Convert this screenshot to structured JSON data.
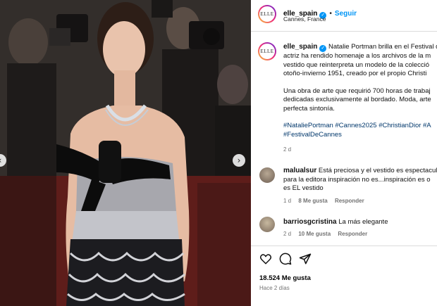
{
  "header": {
    "avatar_text": "ELLE",
    "username": "elle_spain",
    "separator": "•",
    "follow_label": "Seguir",
    "location": "Cannes, France"
  },
  "caption": {
    "username": "elle_spain",
    "lines": [
      "Natalie Portman brilla en el Festival d",
      "actriz ha rendido homenaje a los archivos de la m",
      "vestido que reinterpreta un modelo de la colecció",
      "otoño-invierno 1951, creado por el propio Christi"
    ],
    "lines2": [
      "Una obra de arte que requirió 700 horas de trabaj",
      "dedicadas exclusivamente al bordado. Moda, arte",
      "perfecta sintonía."
    ],
    "hashtags": [
      "#NataliePortman #Cannes2025 #ChristianDior #A",
      "#FestivalDeCannes"
    ],
    "time": "2 d"
  },
  "comments": [
    {
      "username": "malualsur",
      "lines": [
        "Está preciosa y el vestido es espectacul",
        "para la editora inspiración no es...inspiración es o",
        "es EL vestido"
      ],
      "time": "1 d",
      "likes": "8 Me gusta",
      "reply": "Responder"
    },
    {
      "username": "barriosgcristina",
      "text": "La más elegante",
      "time": "2 d",
      "likes": "10 Me gusta",
      "reply": "Responder"
    }
  ],
  "actions": {
    "like_icon": "heart-icon",
    "comment_icon": "comment-icon",
    "share_icon": "share-icon"
  },
  "likes_count": "18.524 Me gusta",
  "posted_ago": "Hace 2 días",
  "carousel": {
    "prev": "‹",
    "next": "›"
  },
  "colors": {
    "accent": "#0095f6",
    "hashtag": "#00376b",
    "muted": "#737373"
  }
}
